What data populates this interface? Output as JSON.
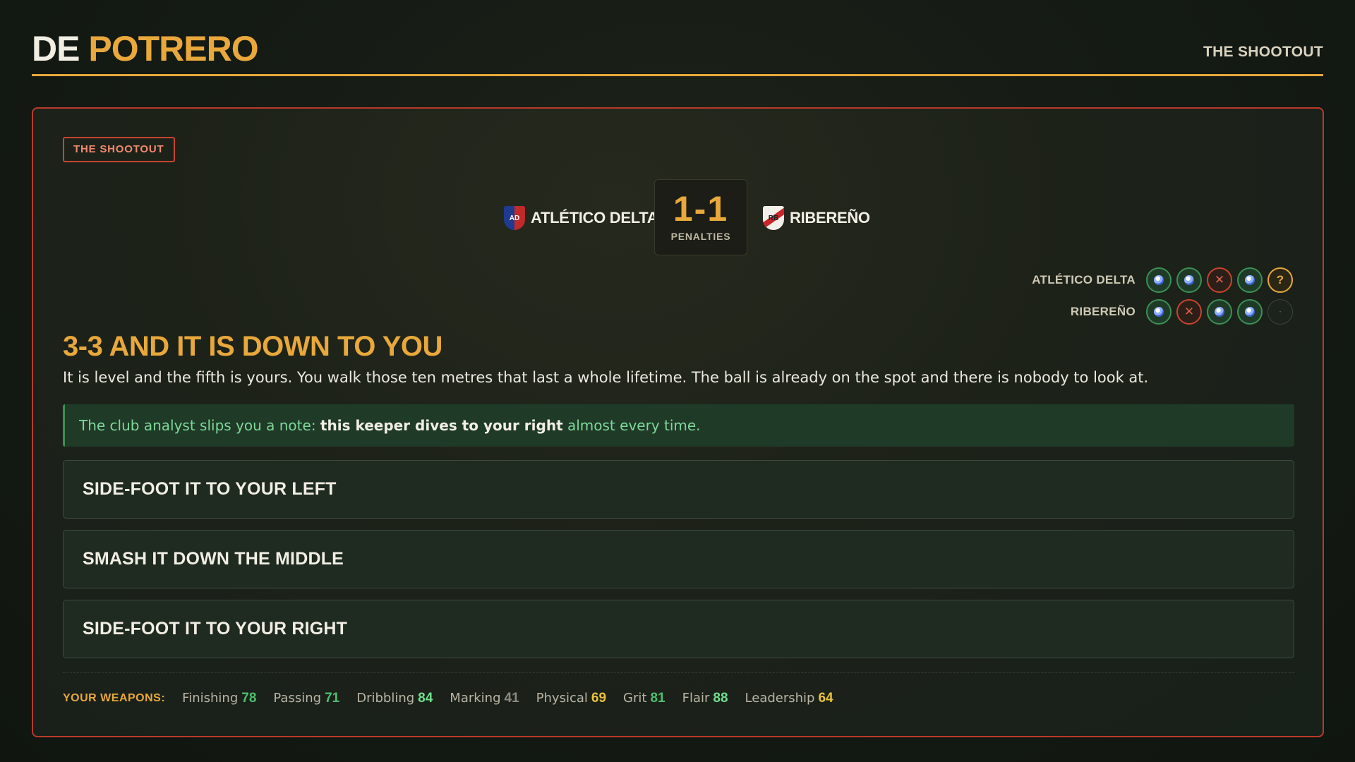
{
  "header": {
    "brand_part1": "DE",
    "brand_part2": "POTRERO",
    "right_label": "THE SHOOTOUT"
  },
  "panel": {
    "tag": "THE SHOOTOUT"
  },
  "match": {
    "home": {
      "name": "ATLÉTICO DELTA",
      "crest_text": "AD",
      "crest_colors": [
        "#1e3b8f",
        "#c02a2a"
      ]
    },
    "away": {
      "name": "RIBEREÑO",
      "crest_text": "RB",
      "crest_colors": [
        "#f3f0ea",
        "#c9242a"
      ]
    },
    "score": "1-1",
    "score_label": "PENALTIES"
  },
  "tally": {
    "home": {
      "name": "ATLÉTICO DELTA",
      "kicks": [
        "goal",
        "goal",
        "miss",
        "goal",
        "pending"
      ]
    },
    "away": {
      "name": "RIBEREÑO",
      "kicks": [
        "goal",
        "miss",
        "goal",
        "goal",
        "empty"
      ]
    },
    "symbols": {
      "miss": "✕",
      "pending": "?",
      "empty": "·"
    }
  },
  "scenario": {
    "headline": "3-3 AND IT IS DOWN TO YOU",
    "narrative": "It is level and the fifth is yours. You walk those ten metres that last a whole lifetime. The ball is already on the spot and there is nobody to look at.",
    "hint_prefix": "The club analyst slips you a note: ",
    "hint_bold": "this keeper dives to your right",
    "hint_suffix": " almost every time."
  },
  "choices": [
    "SIDE-FOOT IT TO YOUR LEFT",
    "SMASH IT DOWN THE MIDDLE",
    "SIDE-FOOT IT TO YOUR RIGHT"
  ],
  "weapons": {
    "label": "YOUR WEAPONS:",
    "stats": [
      {
        "name": "Finishing",
        "value": "78",
        "color": "#4fbf6f"
      },
      {
        "name": "Passing",
        "value": "71",
        "color": "#4fbf6f"
      },
      {
        "name": "Dribbling",
        "value": "84",
        "color": "#6fe08f"
      },
      {
        "name": "Marking",
        "value": "41",
        "color": "#8a8a80"
      },
      {
        "name": "Physical",
        "value": "69",
        "color": "#e8c23b"
      },
      {
        "name": "Grit",
        "value": "81",
        "color": "#4fbf6f"
      },
      {
        "name": "Flair",
        "value": "88",
        "color": "#6fe08f"
      },
      {
        "name": "Leadership",
        "value": "64",
        "color": "#e8c23b"
      }
    ]
  },
  "colors": {
    "accent": "#e8a83b",
    "danger": "#c8442e",
    "success": "#3d8f55"
  }
}
